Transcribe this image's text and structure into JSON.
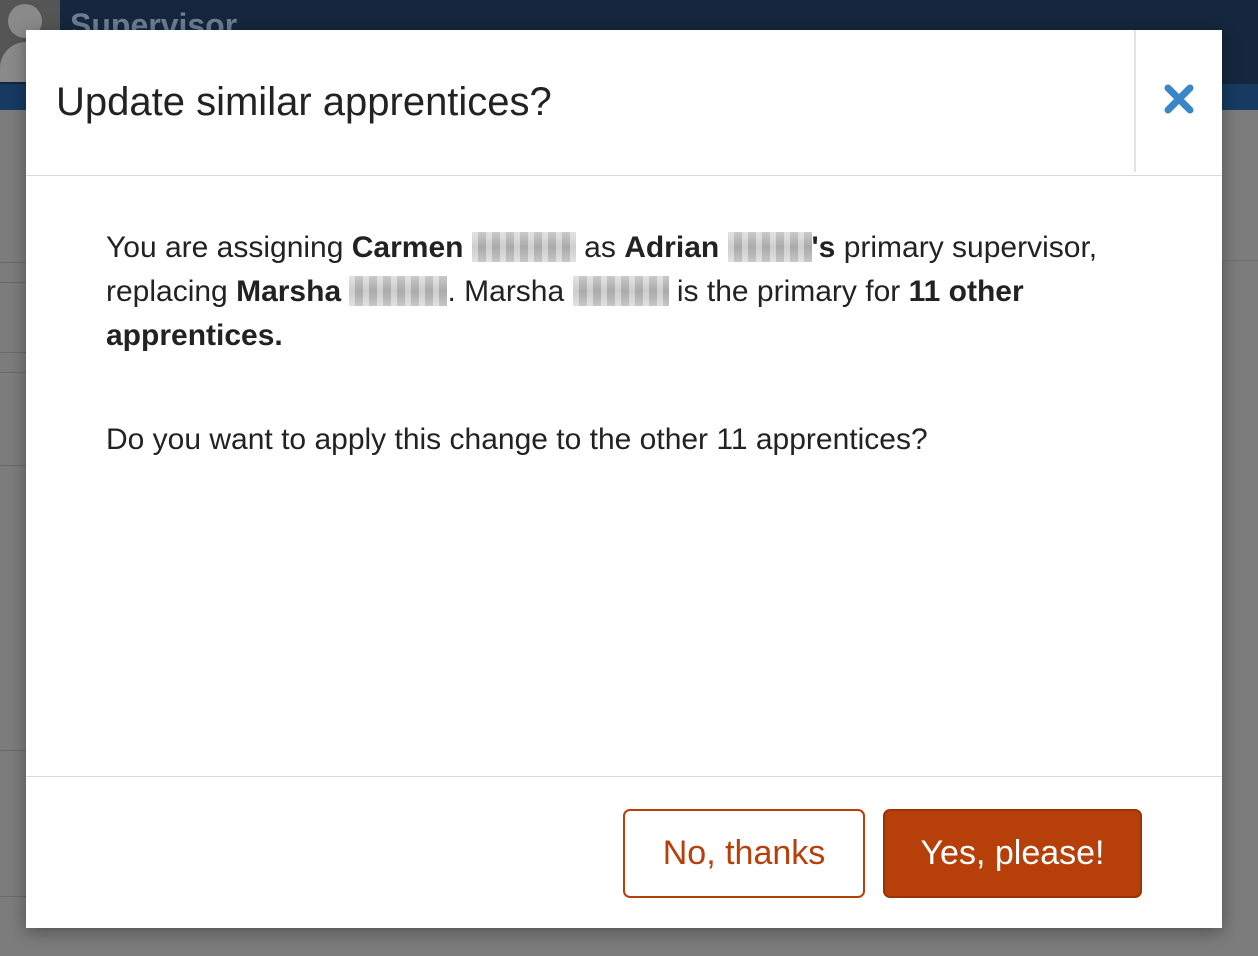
{
  "background": {
    "header_title": "Supervisor ... "
  },
  "modal": {
    "title": "Update similar apprentices?",
    "close_icon": "close-x-icon",
    "close_color": "#3a87c8",
    "body": {
      "p1_part1": "You are assigning ",
      "new_supervisor_first": "Carmen",
      "p1_part2": "as ",
      "apprentice_first": "Adrian",
      "possessive": "'s",
      "p1_part3": " primary supervisor, replacing ",
      "old_supervisor_first": "Marsha",
      "p1_part4": ". Marsha ",
      "p1_part5": "is the primary for ",
      "count_phrase": "11 other apprentices.",
      "question": "Do you want to apply this change to the other 11 apprentices?"
    },
    "buttons": {
      "no_label": "No, thanks",
      "yes_label": "Yes, please!"
    },
    "accent_color": "#b73f0a"
  }
}
